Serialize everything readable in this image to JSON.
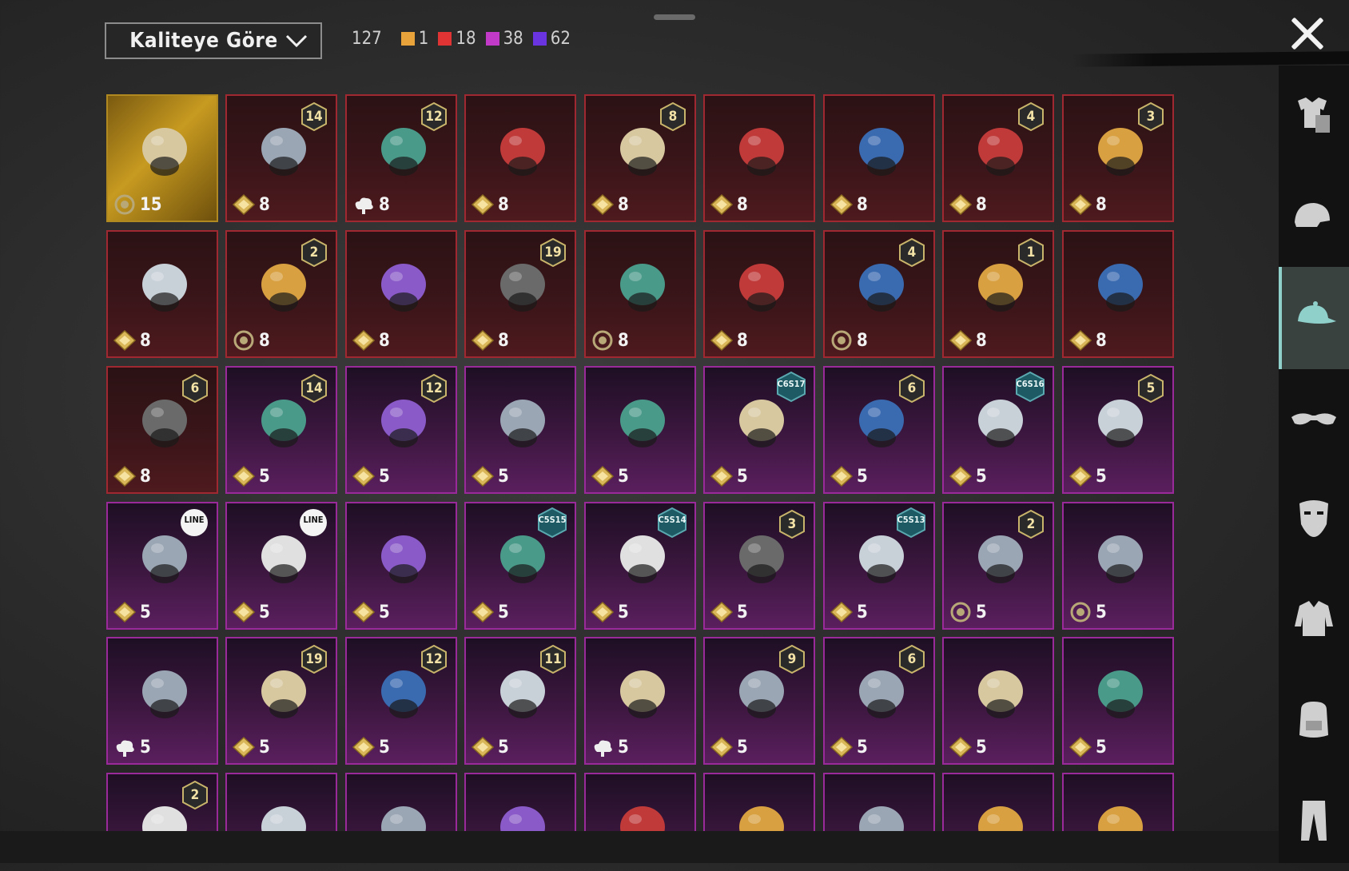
{
  "sort": {
    "label": "Kaliteye Göre"
  },
  "counts": {
    "total": "127",
    "quality": [
      {
        "color": "#e8a33a",
        "value": "1"
      },
      {
        "color": "#e03434",
        "value": "18"
      },
      {
        "color": "#c23ac8",
        "value": "38"
      },
      {
        "color": "#6a34e0",
        "value": "62"
      }
    ]
  },
  "sidebar": [
    "outfit-icon",
    "helmet-icon",
    "hat-icon",
    "glasses-icon",
    "mask-icon",
    "jacket-icon",
    "backpack-icon",
    "pants-icon"
  ],
  "items": [
    {
      "q": "gold",
      "thumb": "gold-helmet",
      "cost": "15",
      "currency": "coin"
    },
    {
      "q": "red",
      "thumb": "cat-mask",
      "badge": "14",
      "cost": "8",
      "currency": "diamond"
    },
    {
      "q": "red",
      "thumb": "grey-hair",
      "badge": "12",
      "cost": "8",
      "currency": "cloud"
    },
    {
      "q": "red",
      "thumb": "white-hat",
      "cost": "8",
      "currency": "diamond"
    },
    {
      "q": "red",
      "thumb": "white-hair",
      "badge": "8",
      "cost": "8",
      "currency": "diamond"
    },
    {
      "q": "red",
      "thumb": "blonde-hair",
      "cost": "8",
      "currency": "diamond"
    },
    {
      "q": "red",
      "thumb": "red-helmet",
      "cost": "8",
      "currency": "diamond"
    },
    {
      "q": "red",
      "thumb": "top-hat-ball",
      "badge": "4",
      "cost": "8",
      "currency": "diamond"
    },
    {
      "q": "red",
      "thumb": "joker-head",
      "badge": "3",
      "cost": "8",
      "currency": "diamond"
    },
    {
      "q": "red",
      "thumb": "dragon-helm",
      "cost": "8",
      "currency": "diamond"
    },
    {
      "q": "red",
      "thumb": "bucket-hat",
      "badge": "2",
      "cost": "8",
      "currency": "coin"
    },
    {
      "q": "red",
      "thumb": "oni-mask",
      "cost": "8",
      "currency": "diamond"
    },
    {
      "q": "red",
      "thumb": "black-helmet",
      "badge": "19",
      "cost": "8",
      "currency": "diamond"
    },
    {
      "q": "red",
      "thumb": "brown-helmet",
      "cost": "8",
      "currency": "coin"
    },
    {
      "q": "red",
      "thumb": "ninja-helm",
      "cost": "8",
      "currency": "diamond"
    },
    {
      "q": "red",
      "thumb": "gold-horn-helm",
      "badge": "4",
      "cost": "8",
      "currency": "coin"
    },
    {
      "q": "red",
      "thumb": "blue-helmet",
      "badge": "1",
      "cost": "8",
      "currency": "diamond"
    },
    {
      "q": "red",
      "thumb": "ghost",
      "cost": "8",
      "currency": "diamond"
    },
    {
      "q": "red",
      "thumb": "tv-head",
      "badge": "6",
      "cost": "8",
      "currency": "diamond"
    },
    {
      "q": "purple",
      "thumb": "flower-hair",
      "badge": "14",
      "cost": "5",
      "currency": "diamond"
    },
    {
      "q": "purple",
      "thumb": "orange-hair",
      "badge": "12",
      "cost": "5",
      "currency": "diamond"
    },
    {
      "q": "purple",
      "thumb": "purple-hair",
      "cost": "5",
      "currency": "diamond"
    },
    {
      "q": "purple",
      "thumb": "pumpkin",
      "cost": "5",
      "currency": "diamond"
    },
    {
      "q": "purple",
      "thumb": "visor-cap",
      "tag": "C6S17",
      "cost": "5",
      "currency": "diamond"
    },
    {
      "q": "purple",
      "thumb": "blade-helm",
      "badge": "6",
      "cost": "5",
      "currency": "diamond"
    },
    {
      "q": "purple",
      "thumb": "red-hood",
      "tag": "C6S16",
      "cost": "5",
      "currency": "diamond"
    },
    {
      "q": "purple",
      "thumb": "cat-ear-hair",
      "badge": "5",
      "cost": "5",
      "currency": "diamond"
    },
    {
      "q": "purple",
      "thumb": "pink-bunny",
      "tag": "LINE",
      "cost": "5",
      "currency": "diamond"
    },
    {
      "q": "purple",
      "thumb": "dragon-bear",
      "tag": "LINE",
      "cost": "5",
      "currency": "diamond"
    },
    {
      "q": "purple",
      "thumb": "lion-mask",
      "cost": "5",
      "currency": "diamond"
    },
    {
      "q": "purple",
      "thumb": "black-cap",
      "tag": "C5S15",
      "cost": "5",
      "currency": "diamond"
    },
    {
      "q": "purple",
      "thumb": "purple-fur",
      "tag": "C5S14",
      "cost": "5",
      "currency": "diamond"
    },
    {
      "q": "purple",
      "thumb": "jester-hat",
      "badge": "3",
      "cost": "5",
      "currency": "diamond"
    },
    {
      "q": "purple",
      "thumb": "teal-horn-hat",
      "tag": "C5S13",
      "cost": "5",
      "currency": "diamond"
    },
    {
      "q": "purple",
      "thumb": "dread-cap",
      "badge": "2",
      "cost": "5",
      "currency": "coin"
    },
    {
      "q": "purple",
      "thumb": "feather-headdress",
      "cost": "5",
      "currency": "coin"
    },
    {
      "q": "purple",
      "thumb": "rabbit-mask",
      "cost": "5",
      "currency": "cloud"
    },
    {
      "q": "purple",
      "thumb": "black-hair",
      "badge": "19",
      "cost": "5",
      "currency": "diamond"
    },
    {
      "q": "purple",
      "thumb": "can-head",
      "badge": "12",
      "cost": "5",
      "currency": "diamond"
    },
    {
      "q": "purple",
      "thumb": "pagoda-hat",
      "badge": "11",
      "cost": "5",
      "currency": "diamond"
    },
    {
      "q": "purple",
      "thumb": "gold-crown",
      "cost": "5",
      "currency": "cloud"
    },
    {
      "q": "purple",
      "thumb": "tentacle-helm",
      "badge": "9",
      "cost": "5",
      "currency": "diamond"
    },
    {
      "q": "purple",
      "thumb": "santa-hat",
      "badge": "6",
      "cost": "5",
      "currency": "diamond"
    },
    {
      "q": "purple",
      "thumb": "green-helm",
      "cost": "5",
      "currency": "diamond"
    },
    {
      "q": "purple",
      "thumb": "yellow-hat",
      "cost": "5",
      "currency": "diamond"
    },
    {
      "q": "purple",
      "thumb": "dark-helmet",
      "badge": "2"
    },
    {
      "q": "purple",
      "thumb": "yellow-helmet"
    },
    {
      "q": "purple",
      "thumb": "tan-hat"
    },
    {
      "q": "purple",
      "thumb": "red-feather-hat"
    },
    {
      "q": "purple",
      "thumb": "gold-mask"
    },
    {
      "q": "purple",
      "thumb": "teal-dome"
    },
    {
      "q": "purple",
      "thumb": "grey-helmet"
    },
    {
      "q": "purple",
      "thumb": "spike-hat"
    },
    {
      "q": "purple",
      "thumb": "blue-helmet"
    }
  ],
  "colors": {
    "red_border": "#a02830",
    "purple_border": "#9a2a9a",
    "gold_border": "#b08a20",
    "active_accent": "#8fd0cb"
  }
}
